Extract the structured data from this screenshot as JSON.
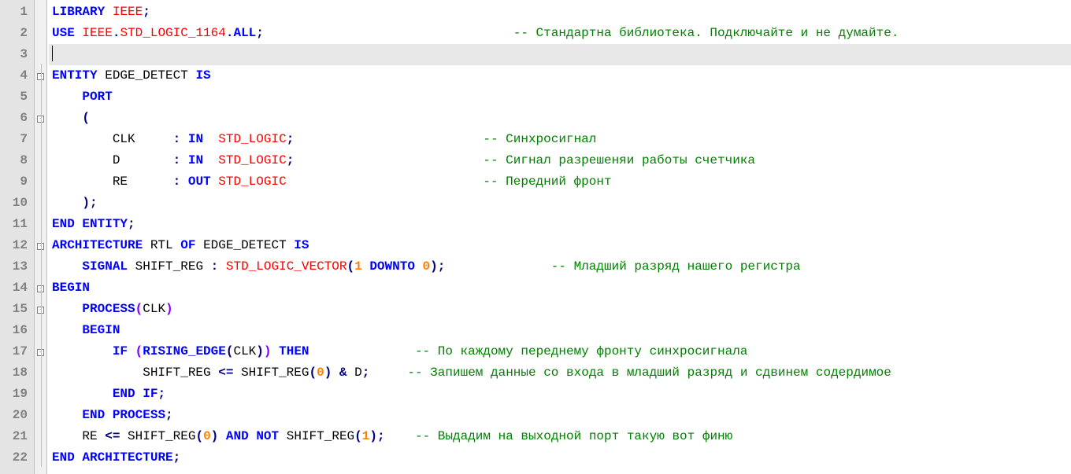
{
  "lines": [
    {
      "n": "1",
      "fold": "",
      "html": "<span class='kw'>LIBRARY</span> <span class='ty'>IEEE</span><span class='op'>;</span>"
    },
    {
      "n": "2",
      "fold": "",
      "html": "<span class='kw'>USE</span> <span class='ty'>IEEE</span><span class='op'>.</span><span class='ty'>STD_LOGIC_1164</span><span class='op'>.</span><span class='kw'>ALL</span><span class='op'>;</span>                                 <span class='cm'>-- Стандартна библиотека. Подключайте и не думайте.</span>"
    },
    {
      "n": "3",
      "fold": "",
      "current": true,
      "html": "<span class='caret'></span>"
    },
    {
      "n": "4",
      "fold": "minus",
      "html": "<span class='kw'>ENTITY</span> <span class='id'>EDGE_DETECT</span> <span class='kw'>IS</span>"
    },
    {
      "n": "5",
      "fold": "line",
      "html": "    <span class='kw'>PORT</span>"
    },
    {
      "n": "6",
      "fold": "minus",
      "html": "    <span class='op'>(</span>"
    },
    {
      "n": "7",
      "fold": "line",
      "html": "        <span class='id'>CLK</span>     <span class='op'>:</span> <span class='kw'>IN</span>  <span class='ty'>STD_LOGIC</span><span class='op'>;</span>                         <span class='cm'>-- Синхросигнал</span>"
    },
    {
      "n": "8",
      "fold": "line",
      "html": "        <span class='id'>D</span>       <span class='op'>:</span> <span class='kw'>IN</span>  <span class='ty'>STD_LOGIC</span><span class='op'>;</span>                         <span class='cm'>-- Сигнал разрешеняи работы счетчика</span>"
    },
    {
      "n": "9",
      "fold": "line",
      "html": "        <span class='id'>RE</span>      <span class='op'>:</span> <span class='kw'>OUT</span> <span class='ty'>STD_LOGIC</span>                          <span class='cm'>-- Передний фронт</span>"
    },
    {
      "n": "10",
      "fold": "line",
      "html": "    <span class='op'>);</span>"
    },
    {
      "n": "11",
      "fold": "line",
      "html": "<span class='kw'>END</span> <span class='kw'>ENTITY</span><span class='op'>;</span>"
    },
    {
      "n": "12",
      "fold": "minus",
      "html": "<span class='kw'>ARCHITECTURE</span> <span class='id'>RTL</span> <span class='kw'>OF</span> <span class='id'>EDGE_DETECT</span> <span class='kw'>IS</span>"
    },
    {
      "n": "13",
      "fold": "line",
      "html": "    <span class='kw'>SIGNAL</span> <span class='id'>SHIFT_REG</span> <span class='op'>:</span> <span class='ty'>STD_LOGIC_VECTOR</span><span class='op'>(</span><span class='num'>1</span> <span class='kw'>DOWNTO</span> <span class='num'>0</span><span class='op'>);</span>              <span class='cm'>-- Младший разряд нашего регистра</span>"
    },
    {
      "n": "14",
      "fold": "minus",
      "html": "<span class='kw'>BEGIN</span>"
    },
    {
      "n": "15",
      "fold": "minus",
      "html": "    <span class='kw'>PROCESS</span><span class='par'>(</span><span class='id'>CLK</span><span class='par'>)</span>"
    },
    {
      "n": "16",
      "fold": "line",
      "html": "    <span class='kw'>BEGIN</span>"
    },
    {
      "n": "17",
      "fold": "minus",
      "html": "        <span class='kw'>IF</span> <span class='par'>(</span><span class='kw'>RISING_EDGE</span><span class='op'>(</span><span class='id'>CLK</span><span class='op'>)</span><span class='par'>)</span> <span class='kw'>THEN</span>              <span class='cm'>-- По каждому переднему фронту синхросигнала</span>"
    },
    {
      "n": "18",
      "fold": "line",
      "html": "            <span class='id'>SHIFT_REG</span> <span class='op'>&lt;=</span> <span class='id'>SHIFT_REG</span><span class='op'>(</span><span class='num'>0</span><span class='op'>)</span> <span class='op'>&amp;</span> <span class='id'>D</span><span class='op'>;</span>     <span class='cm'>-- Запишем данные со входа в младший разряд и сдвинем содердимое</span>"
    },
    {
      "n": "19",
      "fold": "line",
      "html": "        <span class='kw'>END</span> <span class='kw'>IF</span><span class='op'>;</span>"
    },
    {
      "n": "20",
      "fold": "line",
      "html": "    <span class='kw'>END</span> <span class='kw'>PROCESS</span><span class='op'>;</span>"
    },
    {
      "n": "21",
      "fold": "line",
      "html": "    <span class='id'>RE</span> <span class='op'>&lt;=</span> <span class='id'>SHIFT_REG</span><span class='op'>(</span><span class='num'>0</span><span class='op'>)</span> <span class='kw'>AND</span> <span class='kw'>NOT</span> <span class='id'>SHIFT_REG</span><span class='op'>(</span><span class='num'>1</span><span class='op'>);</span>    <span class='cm'>-- Выдадим на выходной порт такую вот финю</span>"
    },
    {
      "n": "22",
      "fold": "line",
      "html": "<span class='kw'>END</span> <span class='kw'>ARCHITECTURE</span><span class='op'>;</span>"
    }
  ]
}
